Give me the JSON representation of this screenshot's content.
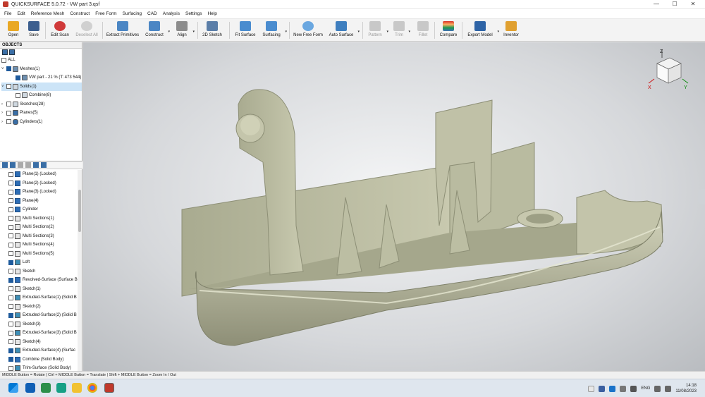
{
  "window": {
    "title": "QUICKSURFACE 5.0.72 - VW part 3.qsf"
  },
  "menu": [
    "File",
    "Edit",
    "Reference Mesh",
    "Construct",
    "Free Form",
    "Surfacing",
    "CAD",
    "Analysis",
    "Settings",
    "Help"
  ],
  "toolbar": {
    "open": "Open",
    "save": "Save",
    "edit_scan": "Edit Scan",
    "deselect_all": "Deselect All",
    "extract_primitives": "Extract Primitives",
    "construct": "Construct",
    "align": "Align",
    "sketch2d": "2D Sketch",
    "fit_surface": "Fit Surface",
    "surfacing": "Surfacing",
    "new_free_form": "New Free Form",
    "auto_surface": "Auto Surface",
    "pattern": "Pattern",
    "trim": "Trim",
    "fillet": "Fillet",
    "compare": "Compare",
    "export_model": "Export Model",
    "inventor": "Inventor"
  },
  "objects": {
    "header": "OBJECTS",
    "tree": [
      {
        "label": "ALL"
      },
      {
        "label": "Meshes(1)"
      },
      {
        "label": "VW part - 21 % (T: 473 544)"
      },
      {
        "label": "Solids(1)"
      },
      {
        "label": "Combine(8)"
      },
      {
        "label": "Sketches(28)"
      },
      {
        "label": "Planes(5)"
      },
      {
        "label": "Cylinders(1)"
      }
    ]
  },
  "history": [
    "Plane(1) (Locked)",
    "Plane(2) (Locked)",
    "Plane(3) (Locked)",
    "Plane(4)",
    "Cylinder",
    "Multi Sections(1)",
    "Multi Sections(2)",
    "Multi Sections(3)",
    "Multi Sections(4)",
    "Multi Sections(5)",
    "Loft",
    "Sketch",
    "Revolved-Surface (Surface B",
    "Sketch(1)",
    "Extruded-Surface(1) (Solid B",
    "Sketch(2)",
    "Extruded-Surface(2) (Solid B",
    "Sketch(3)",
    "Extruded-Surface(3) (Solid B",
    "Sketch(4)",
    "Extruded-Surface(4) (Surfac",
    "Combine (Solid Body)",
    "Trim-Surface (Solid Body)"
  ],
  "viewcube": {
    "x": "X",
    "y": "Y",
    "z": "Z"
  },
  "status": "MIDDLE Button = Rotate | Ctrl + MIDDLE Button = Translate | Shift + MIDDLE Button = Zoom In / Out",
  "taskbar": {
    "lang": "ENG",
    "time": "14:18",
    "date": "11/08/2023"
  },
  "colors": {
    "model": "#c5c6ad",
    "selection": "#cce4f7",
    "accent": "#1e5a9c"
  }
}
